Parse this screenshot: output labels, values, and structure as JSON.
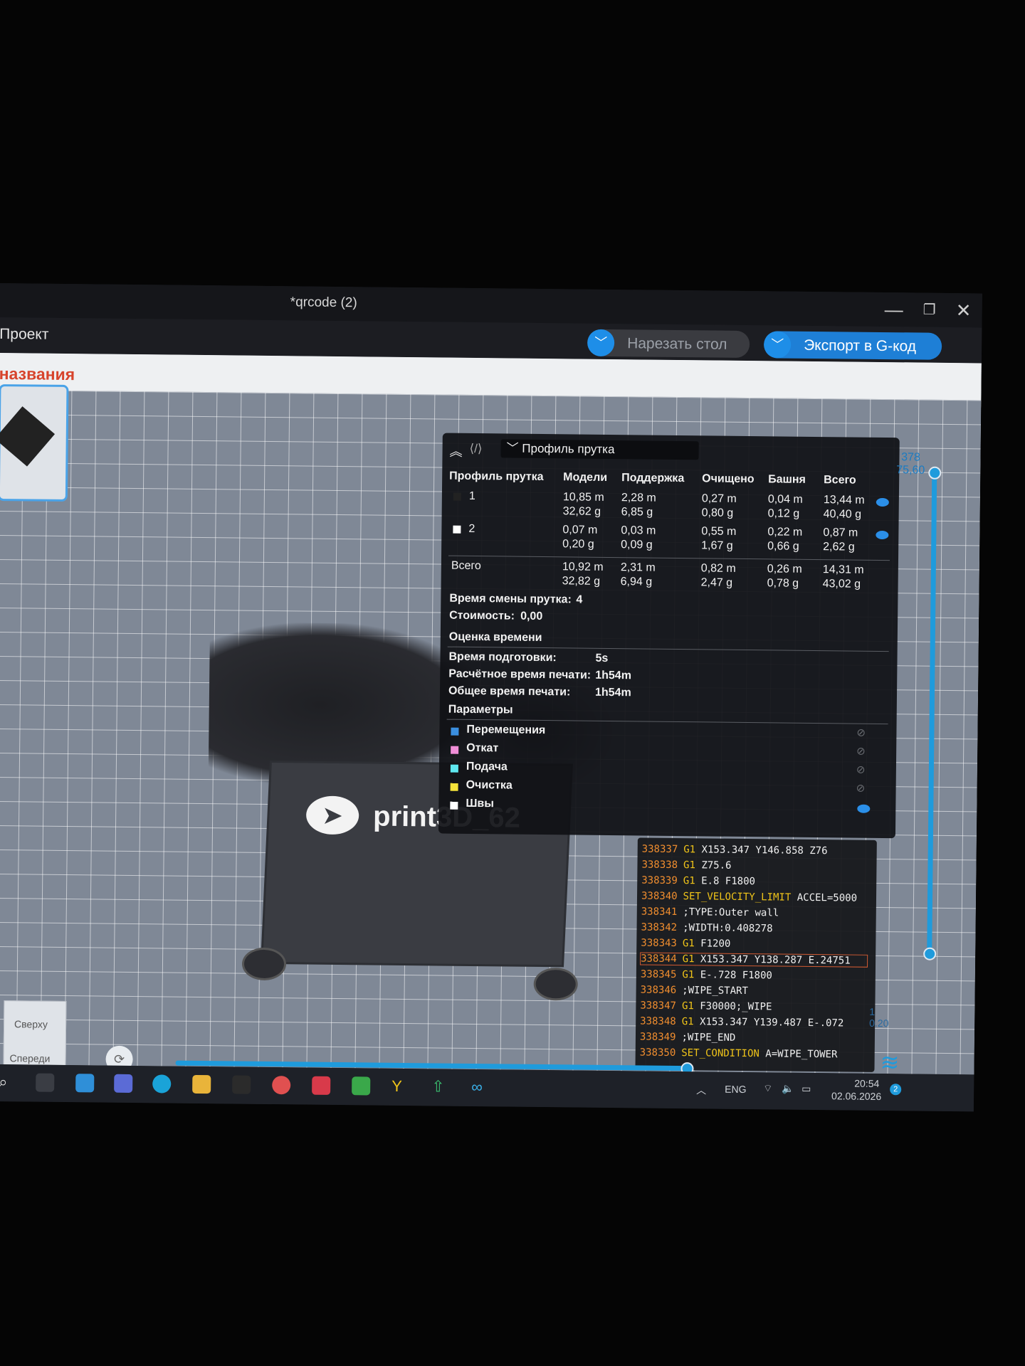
{
  "window": {
    "title": "*qrcode (2)",
    "minimize": "—",
    "restore": "❐",
    "close": "✕"
  },
  "menubar": {
    "project": "Проект",
    "slice_button": "Нарезать стол",
    "export_button": "Экспорт в G-код",
    "dropdown_glyph": "﹀"
  },
  "viewport": {
    "plate_name": "названия",
    "brand_text": "print3D_62",
    "brand_icon": "telegram-icon",
    "view_top": "Сверху",
    "view_front": "Спереди"
  },
  "profile_panel": {
    "collapse_glyph": "︽",
    "selector_label": "Профиль прутка",
    "columns": [
      "Профиль прутка",
      "Модели",
      "Поддержка",
      "Очищено",
      "Башня",
      "Всего"
    ],
    "rows": [
      {
        "name": "1",
        "models": [
          "10,85 m",
          "32,62 g"
        ],
        "support": [
          "2,28 m",
          "6,85 g"
        ],
        "flushed": [
          "0,27 m",
          "0,80 g"
        ],
        "tower": [
          "0,04 m",
          "0,12 g"
        ],
        "total": [
          "13,44 m",
          "40,40 g"
        ],
        "color": "#222222"
      },
      {
        "name": "2",
        "models": [
          "0,07 m",
          "0,20 g"
        ],
        "support": [
          "0,03 m",
          "0,09 g"
        ],
        "flushed": [
          "0,55 m",
          "1,67 g"
        ],
        "tower": [
          "0,22 m",
          "0,66 g"
        ],
        "total": [
          "0,87 m",
          "2,62 g"
        ],
        "color": "#ffffff"
      }
    ],
    "totals": {
      "name": "Всего",
      "models": [
        "10,92 m",
        "32,82 g"
      ],
      "support": [
        "2,31 m",
        "6,94 g"
      ],
      "flushed": [
        "0,82 m",
        "2,47 g"
      ],
      "tower": [
        "0,26 m",
        "0,78 g"
      ],
      "total": [
        "14,31 m",
        "43,02 g"
      ]
    },
    "change_time_label": "Время смены прутка:",
    "change_time_value": "4",
    "cost_label": "Стоимость:",
    "cost_value": "0,00",
    "time_section": "Оценка времени",
    "prep_label": "Время подготовки:",
    "prep_value": "5s",
    "calc_label": "Расчётное время печати:",
    "calc_value": "1h54m",
    "total_label": "Общее время печати:",
    "total_value": "1h54m",
    "params_section": "Параметры",
    "params": [
      {
        "label": "Перемещения",
        "color": "#3b8fe0",
        "visible": false
      },
      {
        "label": "Откат",
        "color": "#f08ed8",
        "visible": false
      },
      {
        "label": "Подача",
        "color": "#5fe8f0",
        "visible": false
      },
      {
        "label": "Очистка",
        "color": "#f5e33a",
        "visible": false
      },
      {
        "label": "Швы",
        "color": "#ffffff",
        "visible": true
      }
    ]
  },
  "gcode": [
    {
      "n": "338337",
      "cmd": "G1",
      "args": "X153.347 Y146.858 Z76"
    },
    {
      "n": "338338",
      "cmd": "G1",
      "args": "Z75.6"
    },
    {
      "n": "338339",
      "cmd": "G1",
      "args": "E.8 F1800"
    },
    {
      "n": "338340",
      "cmd": "SET_VELOCITY_LIMIT",
      "args": "ACCEL=5000"
    },
    {
      "n": "338341",
      "cmd": "",
      "args": ";TYPE:Outer wall"
    },
    {
      "n": "338342",
      "cmd": "",
      "args": ";WIDTH:0.408278"
    },
    {
      "n": "338343",
      "cmd": "G1",
      "args": "F1200"
    },
    {
      "n": "338344",
      "cmd": "G1",
      "args": "X153.347 Y138.287 E.24751",
      "highlight": true
    },
    {
      "n": "338345",
      "cmd": "G1",
      "args": "E-.728 F1800"
    },
    {
      "n": "338346",
      "cmd": "",
      "args": ";WIPE_START"
    },
    {
      "n": "338347",
      "cmd": "G1",
      "args": "F30000;_WIPE"
    },
    {
      "n": "338348",
      "cmd": "G1",
      "args": "X153.347 Y139.487 E-.072"
    },
    {
      "n": "338349",
      "cmd": "",
      "args": ";WIPE_END"
    },
    {
      "n": "338350",
      "cmd": "SET_CONDITION",
      "args": "A=WIPE_TOWER"
    }
  ],
  "layer_slider": {
    "top_layer": "378",
    "top_height": "75,60",
    "bottom_layer": "1",
    "bottom_height": "0.20"
  },
  "horizontal_slider": {
    "progress": 1.0
  },
  "taskbar": {
    "icons": [
      "search-icon",
      "taskview-icon",
      "widgets-icon",
      "chat-icon",
      "edge-icon",
      "explorer-icon",
      "figma-icon",
      "yandex-icon",
      "wps-icon",
      "vpn-icon",
      "ybrowser-icon",
      "upload-icon",
      "slicer-icon"
    ],
    "lang": "ENG",
    "time": "20:54",
    "date": "02.06.2026",
    "notifications": "2"
  }
}
